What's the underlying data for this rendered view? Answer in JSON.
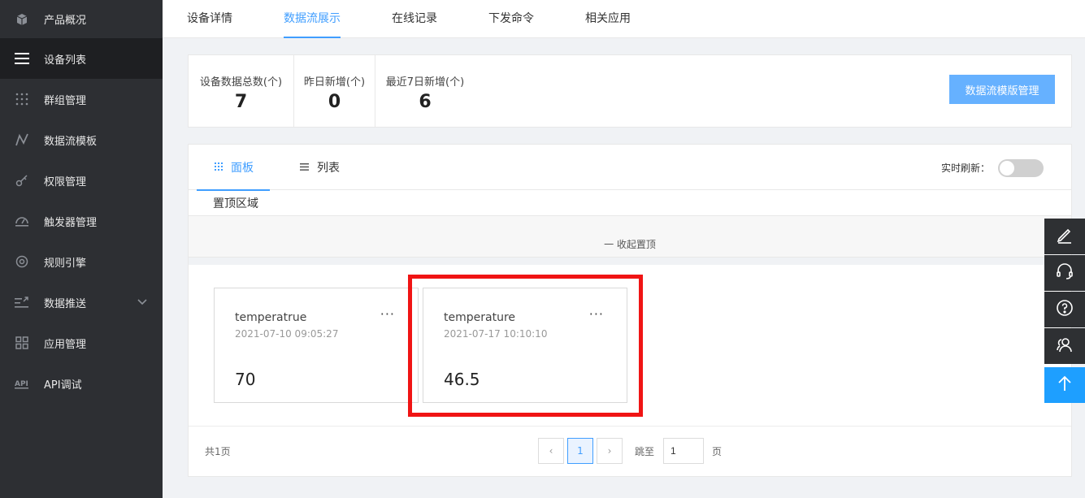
{
  "sidebar": {
    "items": [
      {
        "label": "产品概况",
        "icon": "cube-icon"
      },
      {
        "label": "设备列表",
        "icon": "menu-icon"
      },
      {
        "label": "群组管理",
        "icon": "dots-grid-icon"
      },
      {
        "label": "数据流模板",
        "icon": "line-chart-icon"
      },
      {
        "label": "权限管理",
        "icon": "key-icon"
      },
      {
        "label": "触发器管理",
        "icon": "gauge-icon"
      },
      {
        "label": "规则引擎",
        "icon": "target-icon"
      },
      {
        "label": "数据推送",
        "icon": "push-icon"
      },
      {
        "label": "应用管理",
        "icon": "apps-icon"
      },
      {
        "label": "API调试",
        "icon": "api-icon"
      }
    ]
  },
  "tabs": {
    "items": [
      "设备详情",
      "数据流展示",
      "在线记录",
      "下发命令",
      "相关应用"
    ],
    "active": "数据流展示"
  },
  "stats": {
    "total_label": "设备数据总数(个)",
    "total_value": "7",
    "yesterday_label": "昨日新增(个)",
    "yesterday_value": "0",
    "week_label": "最近7日新增(个)",
    "week_value": "6",
    "manage_button": "数据流模版管理"
  },
  "panel": {
    "tab_board": "面板",
    "tab_list": "列表",
    "refresh_label": "实时刷新：",
    "pin_title": "置顶区域",
    "collapse_label": "一 收起置顶"
  },
  "cards": [
    {
      "name": "temperatrue",
      "time": "2021-07-10 09:05:27",
      "value": "70",
      "more": "···"
    },
    {
      "name": "temperature",
      "time": "2021-07-17 10:10:10",
      "value": "46.5",
      "more": "···"
    }
  ],
  "pager": {
    "total": "共1页",
    "prev": "‹",
    "current": "1",
    "next": "›",
    "jump_label": "跳至",
    "jump_value": "1",
    "page_word": "页"
  },
  "colors": {
    "accent": "#409eff",
    "sidebar_bg": "#2d2f33",
    "highlight": "#f01414",
    "up_button": "#1e9fff"
  }
}
